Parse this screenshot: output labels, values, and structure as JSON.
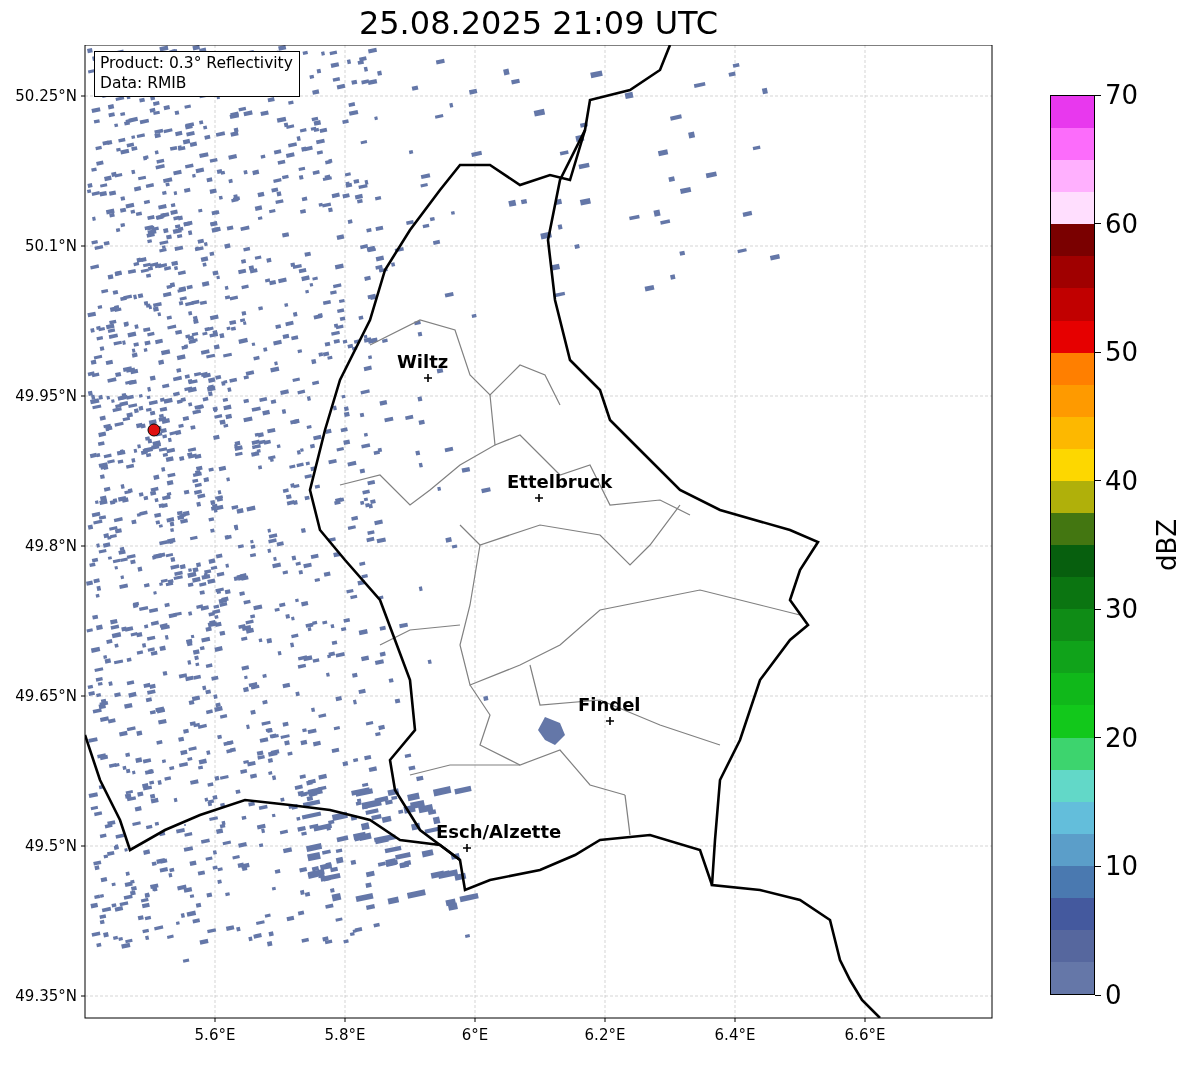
{
  "title": "25.08.2025 21:09 UTC",
  "info_box": [
    "Product: 0.3° Reflectivity",
    "Data: RMIB"
  ],
  "map": {
    "cities": [
      {
        "name": "Wiltz"
      },
      {
        "name": "Ettelbruck"
      },
      {
        "name": "Findel"
      },
      {
        "name": "Esch/Alzette"
      }
    ],
    "lat_ticks": [
      "50.25°N",
      "50.1°N",
      "49.95°N",
      "49.8°N",
      "49.65°N",
      "49.5°N",
      "49.35°N"
    ],
    "lon_ticks": [
      "5.6°E",
      "5.8°E",
      "6°E",
      "6.2°E",
      "6.4°E",
      "6.6°E"
    ]
  },
  "colorbar": {
    "label": "dBZ",
    "ticks": [
      "70",
      "60",
      "50",
      "40",
      "30",
      "20",
      "10",
      "0"
    ],
    "segments": [
      {
        "color": "#e838ee"
      },
      {
        "color": "#fc6cfb"
      },
      {
        "color": "#ffb0fe"
      },
      {
        "color": "#ffdefe"
      },
      {
        "color": "#7a0000"
      },
      {
        "color": "#a00000"
      },
      {
        "color": "#c10000"
      },
      {
        "color": "#e60000"
      },
      {
        "color": "#ff7f00"
      },
      {
        "color": "#fe9a00"
      },
      {
        "color": "#fdb800"
      },
      {
        "color": "#fdd700"
      },
      {
        "color": "#b0b00a"
      },
      {
        "color": "#437611"
      },
      {
        "color": "#075f0e"
      },
      {
        "color": "#0b7511"
      },
      {
        "color": "#0f8c16"
      },
      {
        "color": "#10a31a"
      },
      {
        "color": "#10b81a"
      },
      {
        "color": "#12c81b"
      },
      {
        "color": "#3dd46e"
      },
      {
        "color": "#62d8c8"
      },
      {
        "color": "#63bedb"
      },
      {
        "color": "#5b9ec9"
      },
      {
        "color": "#4a79b0"
      },
      {
        "color": "#44599e"
      },
      {
        "color": "#56679e"
      },
      {
        "color": "#6577a8"
      }
    ]
  }
}
